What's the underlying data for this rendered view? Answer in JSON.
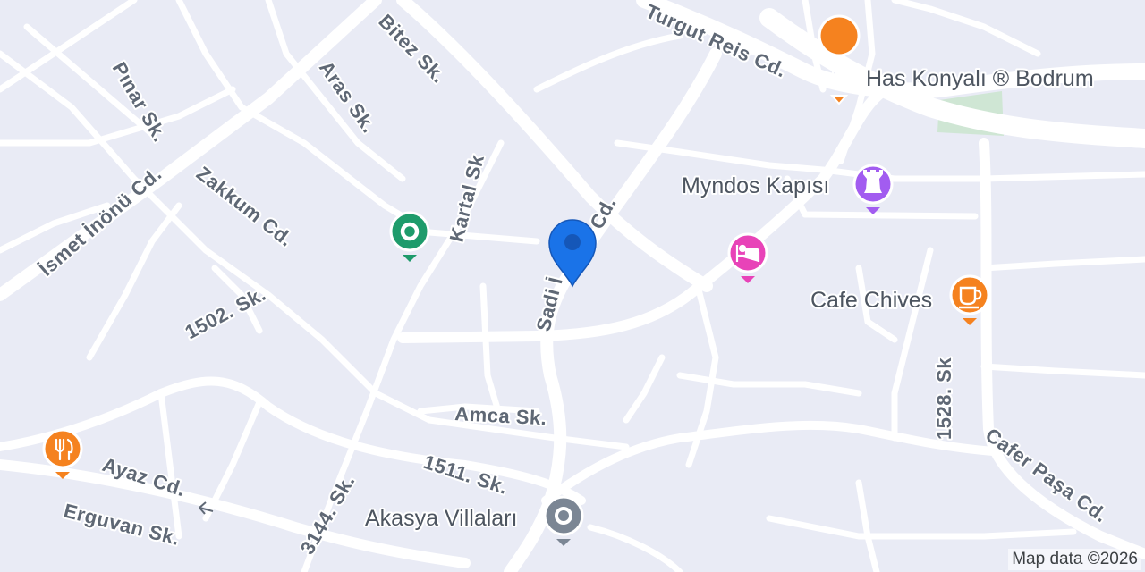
{
  "map": {
    "background_color": "#e9ebf5",
    "road_color": "#ffffff",
    "park_color": "#cfe6d4",
    "attribution": "Map data ©2026"
  },
  "streets": [
    {
      "id": "turgut-reis",
      "label": "Turgut Reis Cd."
    },
    {
      "id": "bitez",
      "label": "Bitez Sk."
    },
    {
      "id": "pinar",
      "label": "Pınar Sk."
    },
    {
      "id": "aras",
      "label": "Aras Sk."
    },
    {
      "id": "ismet-inonu",
      "label": "İsmet İnönü Cd."
    },
    {
      "id": "zakkum",
      "label": "Zakkum Cd."
    },
    {
      "id": "kartal",
      "label": "Kartal Sk"
    },
    {
      "id": "sadi",
      "label": "Sadi İ"
    },
    {
      "id": "sadi-cd",
      "label": "Cd."
    },
    {
      "id": "s1502",
      "label": "1502. Sk."
    },
    {
      "id": "amca",
      "label": "Amca Sk."
    },
    {
      "id": "s1528",
      "label": "1528. Sk"
    },
    {
      "id": "cafer-pasa",
      "label": "Cafer Paşa Cd."
    },
    {
      "id": "s1511",
      "label": "1511. Sk."
    },
    {
      "id": "ayaz",
      "label": "Ayaz Cd."
    },
    {
      "id": "erguvan",
      "label": "Erguvan Sk."
    },
    {
      "id": "s3144",
      "label": "3144. Sk."
    }
  ],
  "pois": [
    {
      "id": "has-konyali",
      "label": "Has Konyalı ® Bodrum",
      "icon": "restaurant-icon",
      "color": "#f5821f"
    },
    {
      "id": "myndos-kapisi",
      "label": "Myndos Kapısı",
      "icon": "landmark-icon",
      "color": "#a25cf0"
    },
    {
      "id": "cafe-chives",
      "label": "Cafe Chives",
      "icon": "cafe-icon",
      "color": "#f5821f"
    },
    {
      "id": "akasya-villalari",
      "label": "Akasya Villaları",
      "icon": "place-icon",
      "color": "#7b8694"
    },
    {
      "id": "hotel",
      "label": "",
      "icon": "hotel-icon",
      "color": "#e843b8"
    },
    {
      "id": "green-place",
      "label": "",
      "icon": "place-icon",
      "color": "#1e9b6b"
    },
    {
      "id": "restaurant-left",
      "label": "",
      "icon": "restaurant-icon",
      "color": "#f5821f"
    }
  ],
  "selected_location": {
    "icon": "map-pin-icon",
    "color": "#1a73e8"
  }
}
